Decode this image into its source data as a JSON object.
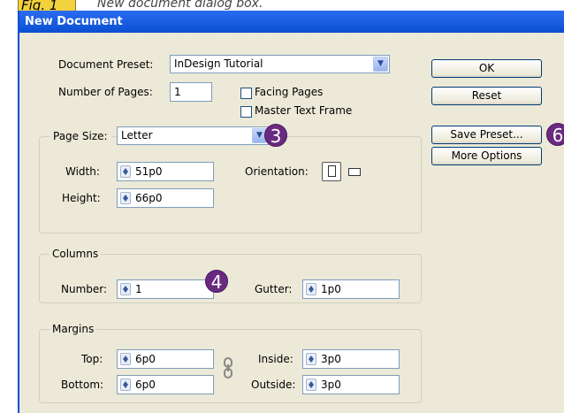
{
  "figure": {
    "label": "Fig. 1",
    "caption": "New document dialog box."
  },
  "dialog": {
    "title": "New Document",
    "document_preset": {
      "label": "Document Preset:",
      "value": "InDesign Tutorial"
    },
    "number_of_pages": {
      "label": "Number of Pages:",
      "value": "1"
    },
    "facing_pages": {
      "label": "Facing Pages",
      "checked": false
    },
    "master_text_frame": {
      "label": "Master Text Frame",
      "checked": false
    },
    "page_size": {
      "label": "Page Size:",
      "value": "Letter",
      "width_label": "Width:",
      "width": "51p0",
      "height_label": "Height:",
      "height": "66p0",
      "orientation_label": "Orientation:",
      "orientation": "portrait"
    },
    "columns": {
      "title": "Columns",
      "number_label": "Number:",
      "number": "1",
      "gutter_label": "Gutter:",
      "gutter": "1p0"
    },
    "margins": {
      "title": "Margins",
      "top_label": "Top:",
      "top": "6p0",
      "bottom_label": "Bottom:",
      "bottom": "6p0",
      "inside_label": "Inside:",
      "inside": "3p0",
      "outside_label": "Outside:",
      "outside": "3p0"
    },
    "buttons": {
      "ok": "OK",
      "reset": "Reset",
      "save_preset": "Save Preset...",
      "more_options": "More Options"
    },
    "callouts": [
      "3",
      "4",
      "6"
    ]
  },
  "colors": {
    "titlebar": "#0a4fd2",
    "dialog_bg": "#ece9d8",
    "callout": "#6a2a80",
    "fig_label_bg": "#f2d23c"
  },
  "icons": [
    "dropdown-arrow-icon",
    "spinner-icon",
    "chain-link-icon",
    "portrait-orientation-icon",
    "landscape-orientation-icon"
  ]
}
